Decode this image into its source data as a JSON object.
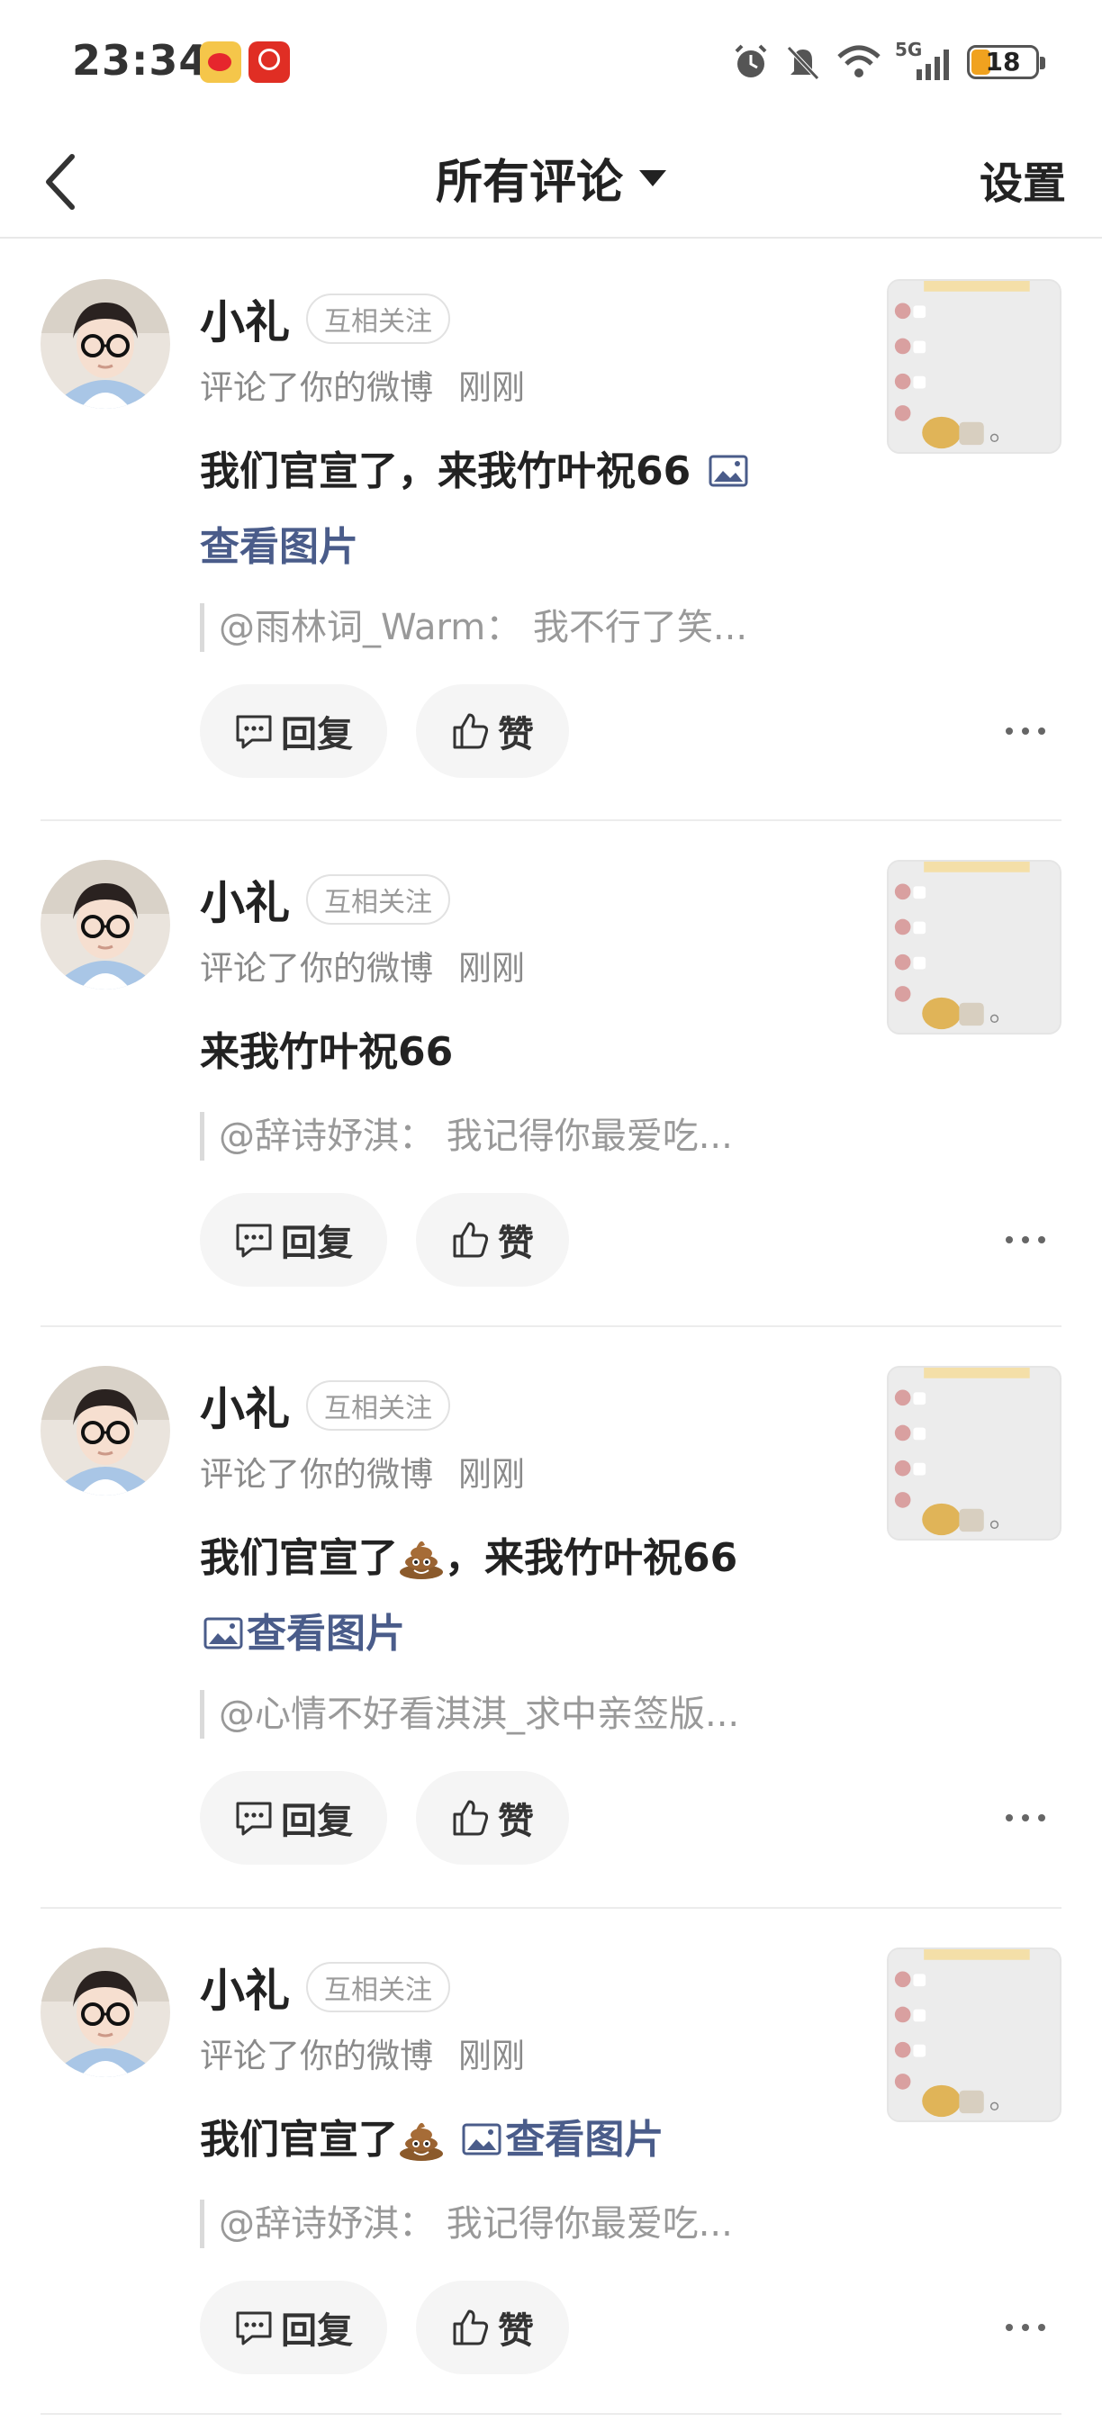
{
  "status_bar": {
    "time": "23:34",
    "network": "5G",
    "battery": "18",
    "icons": [
      "weibo-app-icon",
      "pinduoduo-app-icon",
      "alarm-icon",
      "mute-icon",
      "wifi-icon",
      "signal-icon",
      "battery-icon"
    ]
  },
  "header": {
    "title": "所有评论",
    "settings_label": "设置"
  },
  "comments": [
    {
      "user": "小礼",
      "badge": "互相关注",
      "action": "评论了你的微博",
      "time": "刚刚",
      "text": "我们官宣了，来我竹叶祝66",
      "link": "查看图片",
      "quote": "@雨林词_Warm： 我不行了笑...",
      "reply_label": "回复",
      "like_label": "赞"
    },
    {
      "user": "小礼",
      "badge": "互相关注",
      "action": "评论了你的微博",
      "time": "刚刚",
      "text": "来我竹叶祝66",
      "quote": "@辞诗妤淇： 我记得你最爱吃...",
      "reply_label": "回复",
      "like_label": "赞"
    },
    {
      "user": "小礼",
      "badge": "互相关注",
      "action": "评论了你的微博",
      "time": "刚刚",
      "text_a": "我们官宣了",
      "text_b": "，来我竹叶祝66",
      "link": "查看图片",
      "quote": "@心情不好看淇淇_求中亲签版...",
      "reply_label": "回复",
      "like_label": "赞"
    },
    {
      "user": "小礼",
      "badge": "互相关注",
      "action": "评论了你的微博",
      "time": "刚刚",
      "text": "我们官宣了",
      "link": "查看图片",
      "quote": "@辞诗妤淇： 我记得你最爱吃...",
      "reply_label": "回复",
      "like_label": "赞"
    }
  ],
  "colors": {
    "link": "#4a5c8a",
    "battery_fill": "#f0a21f",
    "secondary_text": "#8a8a8a"
  }
}
